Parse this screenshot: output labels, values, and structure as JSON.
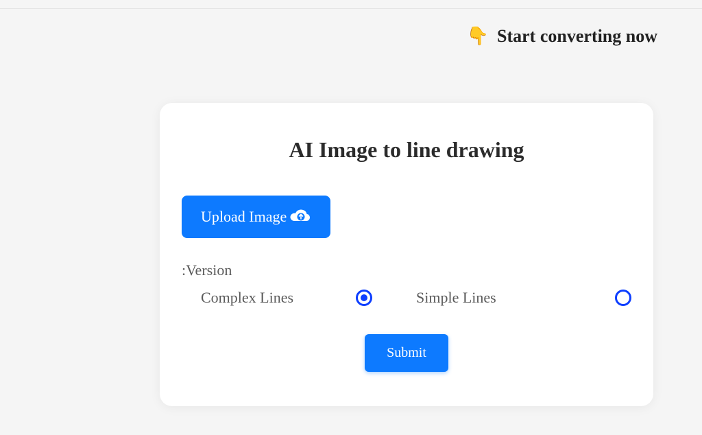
{
  "cta": {
    "icon": "👇",
    "text": "Start converting now"
  },
  "card": {
    "title": "AI Image to line drawing",
    "upload_label": "Upload Image",
    "version_label": ":Version",
    "options": {
      "complex": "Complex Lines",
      "simple": "Simple Lines"
    },
    "submit_label": "Submit"
  }
}
